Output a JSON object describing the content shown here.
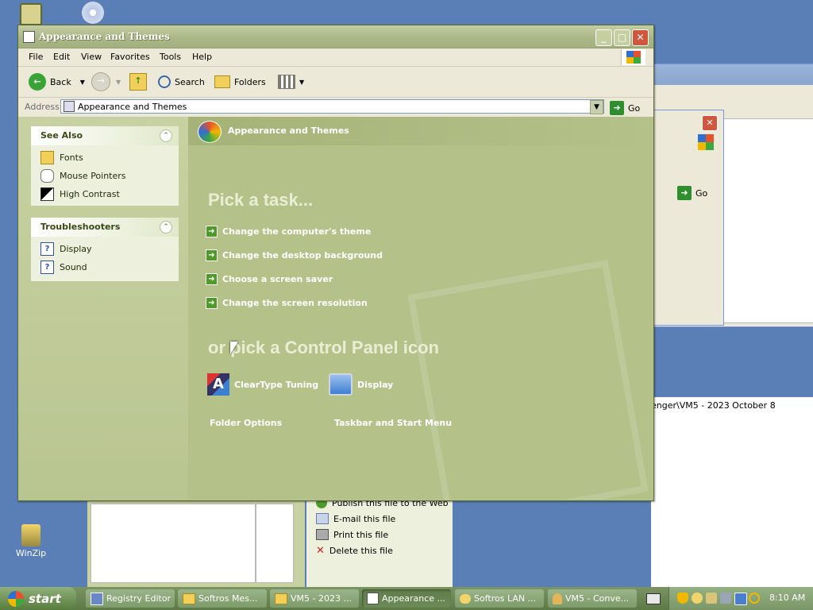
{
  "window": {
    "title": "Appearance and Themes",
    "menu": [
      "File",
      "Edit",
      "View",
      "Favorites",
      "Tools",
      "Help"
    ],
    "toolbar": {
      "back": "Back",
      "search": "Search",
      "folders": "Folders"
    },
    "address": {
      "label": "Address",
      "value": "Appearance and Themes",
      "go": "Go"
    }
  },
  "see_also": {
    "title": "See Also",
    "items": [
      {
        "label": "Fonts",
        "icon": "folder-icon"
      },
      {
        "label": "Mouse Pointers",
        "icon": "mouse-icon"
      },
      {
        "label": "High Contrast",
        "icon": "contrast-icon"
      }
    ]
  },
  "troubleshooters": {
    "title": "Troubleshooters",
    "items": [
      {
        "label": "Display",
        "icon": "help-icon"
      },
      {
        "label": "Sound",
        "icon": "help-icon"
      }
    ]
  },
  "content": {
    "header": "Appearance and Themes",
    "pick_task": "Pick a task...",
    "tasks": [
      "Change the computer's theme",
      "Change the desktop background",
      "Choose a screen saver",
      "Change the screen resolution"
    ],
    "pick_icon": "or pick a Control Panel icon",
    "icons": [
      "ClearType Tuning",
      "Display",
      "Folder Options",
      "Taskbar and Start Menu"
    ]
  },
  "background_window": {
    "go": "Go",
    "path_text": "enger\\VM5 - 2023 October 8",
    "file_tasks": [
      "Publish this file to the Web",
      "E-mail this file",
      "Print this file",
      "Delete this file"
    ]
  },
  "desktop": {
    "winzip_label": "WinZip"
  },
  "taskbar": {
    "start": "start",
    "buttons": [
      "Registry Editor",
      "Softros Mes...",
      "VM5 - 2023 ...",
      "Appearance ...",
      "Softros LAN ...",
      "VM5 - Conve..."
    ],
    "clock": "8:10 AM"
  }
}
